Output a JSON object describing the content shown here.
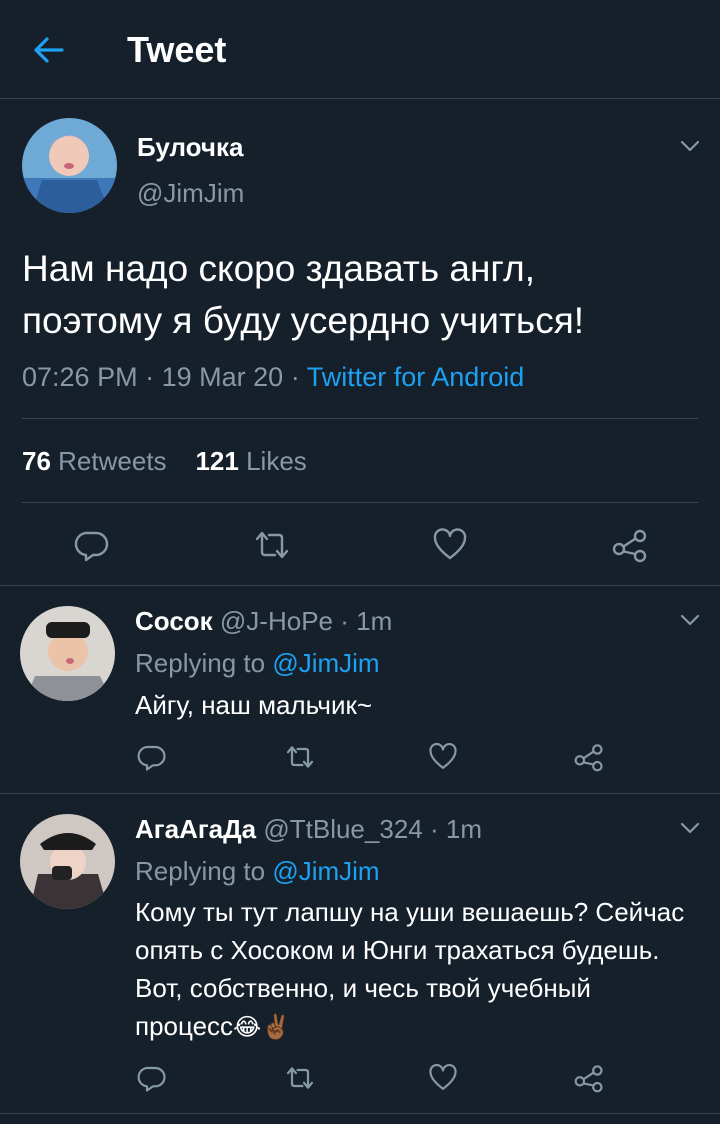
{
  "header": {
    "title": "Tweet"
  },
  "tweet": {
    "name": "Булочка",
    "handle": "@JimJim",
    "text_line1": "Нам надо скоро здавать англ,",
    "text_line2": "поэтому я буду усердно учиться!",
    "time": "07:26 PM",
    "date": "19 Mar 20",
    "source": "Twitter for Android",
    "retweets_count": "76",
    "retweets_label": "Retweets",
    "likes_count": "121",
    "likes_label": "Likes"
  },
  "replies": [
    {
      "name": "Сосок",
      "handle": "@J-HoPe",
      "age": "1m",
      "replying_prefix": "Replying to",
      "replying_to": "@JimJim",
      "text": "Айгу, наш мальчик~"
    },
    {
      "name": "АгаАгаДа",
      "handle": "@TtBlue_324",
      "age": "1m",
      "replying_prefix": "Replying to",
      "replying_to": "@JimJim",
      "text": "Кому ты тут лапшу на уши вешаешь? Сейчас опять с Хосоком и Юнги трахаться будешь. Вот, собственно, и чесь твой учебный процесс",
      "emojis": "😂✌🏾"
    }
  ],
  "icons": [
    "back-arrow-icon",
    "chevron-down-icon",
    "reply-icon",
    "retweet-icon",
    "like-icon",
    "share-icon"
  ],
  "colors": {
    "background": "#15202b",
    "accent": "#1da1f2",
    "secondary_text": "#8899a6",
    "divider": "#38444d"
  }
}
